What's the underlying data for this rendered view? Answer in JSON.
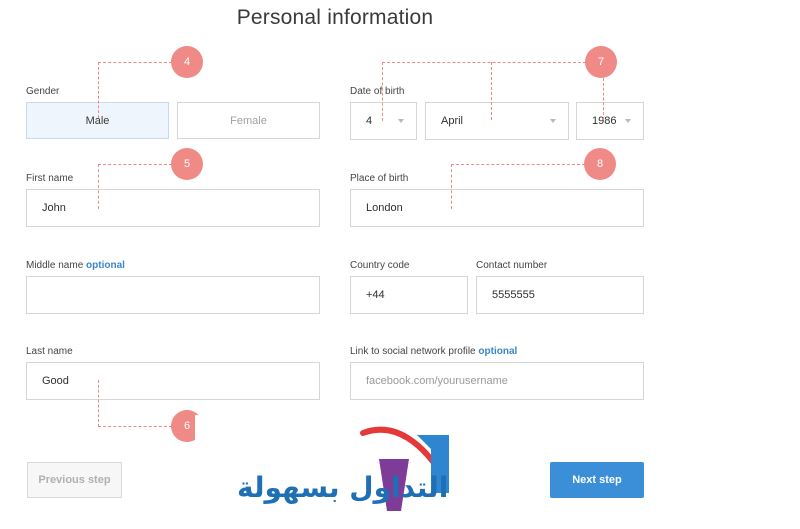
{
  "title": "Personal information",
  "gender": {
    "label": "Gender",
    "options": [
      "Male",
      "Female"
    ],
    "selected": "Male"
  },
  "first_name": {
    "label": "First name",
    "value": "John"
  },
  "middle_name": {
    "label": "Middle name",
    "optional": "optional",
    "value": ""
  },
  "last_name": {
    "label": "Last name",
    "value": "Good"
  },
  "date_of_birth": {
    "label": "Date of birth",
    "day": "4",
    "month": "April",
    "year": "1986"
  },
  "place_of_birth": {
    "label": "Place of birth",
    "value": "London"
  },
  "country_code": {
    "label": "Country code",
    "value": "+44"
  },
  "contact_number": {
    "label": "Contact number",
    "value": "5555555"
  },
  "social_link": {
    "label": "Link to social network profile",
    "optional": "optional",
    "placeholder": "facebook.com/yourusername"
  },
  "callouts": [
    "4",
    "5",
    "6",
    "7",
    "8"
  ],
  "buttons": {
    "previous": "Previous step",
    "next": "Next step"
  },
  "watermark": {
    "text": "التداول بسهولة"
  },
  "colors": {
    "accent": "#3a8fd8",
    "callout": "#f08a86",
    "selected_bg": "#eef5fc"
  }
}
